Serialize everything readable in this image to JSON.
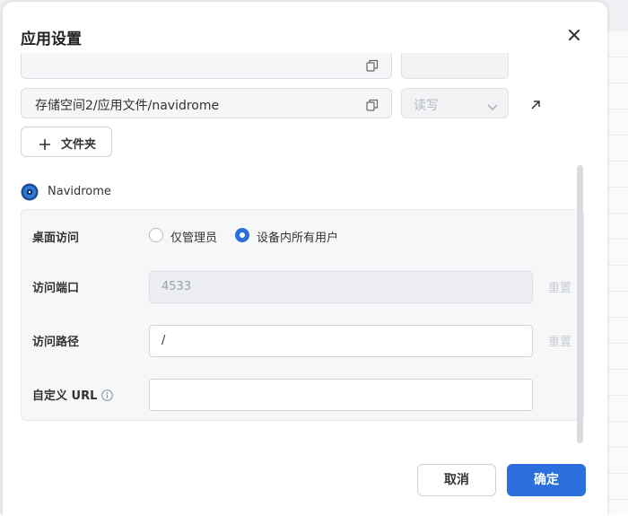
{
  "dialog": {
    "title": "应用设置",
    "close_icon": "close-icon"
  },
  "folders": [
    {
      "path": "",
      "permission": ""
    },
    {
      "path": "存储空间2/应用文件/navidrome",
      "permission": "读写"
    }
  ],
  "add_folder_label": "文件夹",
  "app": {
    "name": "Navidrome",
    "icon": "navidrome-disc-icon"
  },
  "settings": {
    "desktop_access": {
      "label": "桌面访问",
      "options": [
        "仅管理员",
        "设备内所有用户"
      ],
      "selected": "设备内所有用户"
    },
    "port": {
      "label": "访问端口",
      "value": "4533",
      "reset_label": "重置"
    },
    "path": {
      "label": "访问路径",
      "value": "/",
      "reset_label": "重置"
    },
    "custom_url": {
      "label": "自定义 URL",
      "value": ""
    }
  },
  "footer": {
    "cancel_label": "取消",
    "confirm_label": "确定"
  },
  "colors": {
    "accent": "#2a6fdb",
    "panel_bg": "#f6f7f9"
  }
}
